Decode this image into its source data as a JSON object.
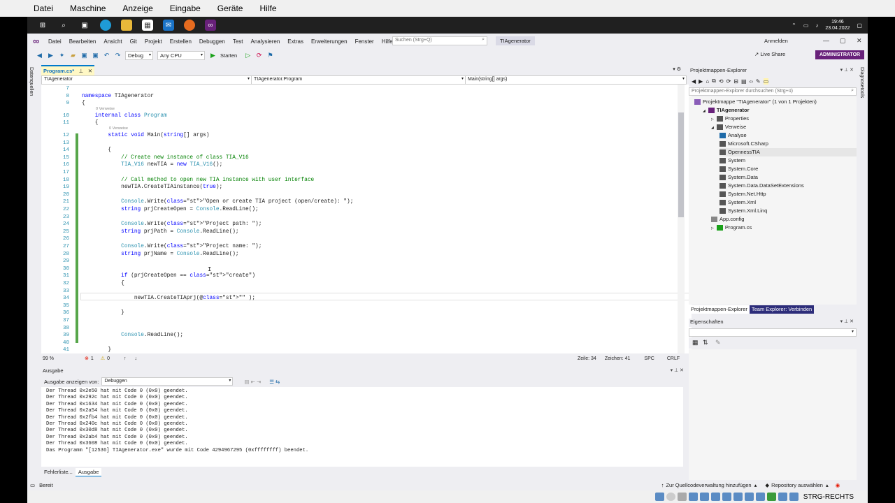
{
  "host_menu": {
    "items": [
      "Datei",
      "Maschine",
      "Anzeige",
      "Eingabe",
      "Geräte",
      "Hilfe"
    ]
  },
  "taskbar": {
    "time": "19:46",
    "date": "23.04.2022"
  },
  "vs_menu": {
    "items": [
      "Datei",
      "Bearbeiten",
      "Ansicht",
      "Git",
      "Projekt",
      "Erstellen",
      "Debuggen",
      "Test",
      "Analysieren",
      "Extras",
      "Erweiterungen",
      "Fenster",
      "Hilfe"
    ],
    "search_placeholder": "Suchen (Strg+Q)",
    "project_name": "TIAgenerator",
    "signin": "Anmelden",
    "live_share": "Live Share",
    "admin_badge": "ADMINISTRATOR"
  },
  "toolbar": {
    "config": "Debug",
    "platform": "Any CPU",
    "start": "Starten"
  },
  "left_strip": "Datenquellen",
  "right_strip": "Diagnosetools",
  "editor": {
    "tab": "Program.cs*",
    "nav": [
      "TIAgenerator",
      "TIAgenerator.Program",
      "Main(string[] args)"
    ],
    "refs": "0 Verweise",
    "lines": [
      {
        "n": "7",
        "t": ""
      },
      {
        "n": "8",
        "t": "namespace TIAgenerator"
      },
      {
        "n": "9",
        "t": "{"
      },
      {
        "n": "10",
        "t": "    internal class Program"
      },
      {
        "n": "11",
        "t": "    {"
      },
      {
        "n": "12",
        "t": "        static void Main(string[] args)"
      },
      {
        "n": "13",
        "t": ""
      },
      {
        "n": "14",
        "t": "        {"
      },
      {
        "n": "15",
        "t": "            // Create new instance of class TIA_V16"
      },
      {
        "n": "16",
        "t": "            TIA_V16 newTIA = new TIA_V16();"
      },
      {
        "n": "17",
        "t": ""
      },
      {
        "n": "18",
        "t": "            // Call method to open new TIA instance with user interface"
      },
      {
        "n": "19",
        "t": "            newTIA.CreateTIAinstance(true);"
      },
      {
        "n": "20",
        "t": ""
      },
      {
        "n": "21",
        "t": "            Console.Write(\"Open or create TIA project (open/create): \");"
      },
      {
        "n": "22",
        "t": "            string prjCreateOpen = Console.ReadLine();"
      },
      {
        "n": "23",
        "t": ""
      },
      {
        "n": "24",
        "t": "            Console.Write(\"Project path: \");"
      },
      {
        "n": "25",
        "t": "            string prjPath = Console.ReadLine();"
      },
      {
        "n": "26",
        "t": ""
      },
      {
        "n": "27",
        "t": "            Console.Write(\"Project name: \");"
      },
      {
        "n": "28",
        "t": "            string prjName = Console.ReadLine();"
      },
      {
        "n": "29",
        "t": ""
      },
      {
        "n": "30",
        "t": ""
      },
      {
        "n": "31",
        "t": "            if (prjCreateOpen == \"create\")"
      },
      {
        "n": "32",
        "t": "            {"
      },
      {
        "n": "33",
        "t": ""
      },
      {
        "n": "34",
        "t": "                newTIA.CreateTIAprj(@\"\" );"
      },
      {
        "n": "35",
        "t": ""
      },
      {
        "n": "36",
        "t": "            }"
      },
      {
        "n": "37",
        "t": ""
      },
      {
        "n": "38",
        "t": ""
      },
      {
        "n": "39",
        "t": "            Console.ReadLine();"
      },
      {
        "n": "40",
        "t": ""
      },
      {
        "n": "41",
        "t": "        }"
      }
    ],
    "status": {
      "zoom": "99 %",
      "errors": "1",
      "warnings": "0",
      "line": "Zeile: 34",
      "col": "Zeichen: 41",
      "mode": "SPC",
      "eol": "CRLF"
    }
  },
  "output": {
    "title": "Ausgabe",
    "show_label": "Ausgabe anzeigen von:",
    "source": "Debuggen",
    "lines": [
      "Der Thread 0x2e50 hat mit Code 0 (0x0) geendet.",
      "Der Thread 0x292c hat mit Code 0 (0x0) geendet.",
      "Der Thread 0x1634 hat mit Code 0 (0x0) geendet.",
      "Der Thread 0x2a54 hat mit Code 0 (0x0) geendet.",
      "Der Thread 0x2fb4 hat mit Code 0 (0x0) geendet.",
      "Der Thread 0x240c hat mit Code 0 (0x0) geendet.",
      "Der Thread 0x30d8 hat mit Code 0 (0x0) geendet.",
      "Der Thread 0x2ab4 hat mit Code 0 (0x0) geendet.",
      "Der Thread 0x3608 hat mit Code 0 (0x0) geendet.",
      "Das Programm \"[12536] TIAgenerator.exe\" wurde mit Code 4294967295 (0xffffffff) beendet."
    ],
    "tabs": [
      "Fehlerliste...",
      "Ausgabe"
    ]
  },
  "solution": {
    "title": "Projektmappen-Explorer",
    "search_placeholder": "Projektmappen-Explorer durchsuchen (Strg+ü)",
    "items": [
      {
        "label": "Projektmappe \"TIAgenerator\" (1 von 1 Projekten)",
        "indent": 0,
        "bold": false
      },
      {
        "label": "TIAgenerator",
        "indent": 1,
        "bold": true
      },
      {
        "label": "Properties",
        "indent": 2,
        "bold": false
      },
      {
        "label": "Verweise",
        "indent": 2,
        "bold": false
      },
      {
        "label": "Analyse",
        "indent": 3,
        "bold": false
      },
      {
        "label": "Microsoft.CSharp",
        "indent": 3,
        "bold": false
      },
      {
        "label": "OpennessTIA",
        "indent": 3,
        "bold": false
      },
      {
        "label": "System",
        "indent": 3,
        "bold": false
      },
      {
        "label": "System.Core",
        "indent": 3,
        "bold": false
      },
      {
        "label": "System.Data",
        "indent": 3,
        "bold": false
      },
      {
        "label": "System.Data.DataSetExtensions",
        "indent": 3,
        "bold": false
      },
      {
        "label": "System.Net.Http",
        "indent": 3,
        "bold": false
      },
      {
        "label": "System.Xml",
        "indent": 3,
        "bold": false
      },
      {
        "label": "System.Xml.Linq",
        "indent": 3,
        "bold": false
      },
      {
        "label": "App.config",
        "indent": 2,
        "bold": false
      },
      {
        "label": "Program.cs",
        "indent": 2,
        "bold": false
      }
    ],
    "tabs": [
      "Projektmappen-Explorer",
      "Team Explorer: Verbinden"
    ]
  },
  "properties": {
    "title": "Eigenschaften"
  },
  "status_bar": {
    "ready": "Bereit",
    "scm": "Zur Quellcodeverwaltung hinzufügen",
    "repo": "Repository auswählen"
  },
  "host_key": "STRG-RECHTS"
}
